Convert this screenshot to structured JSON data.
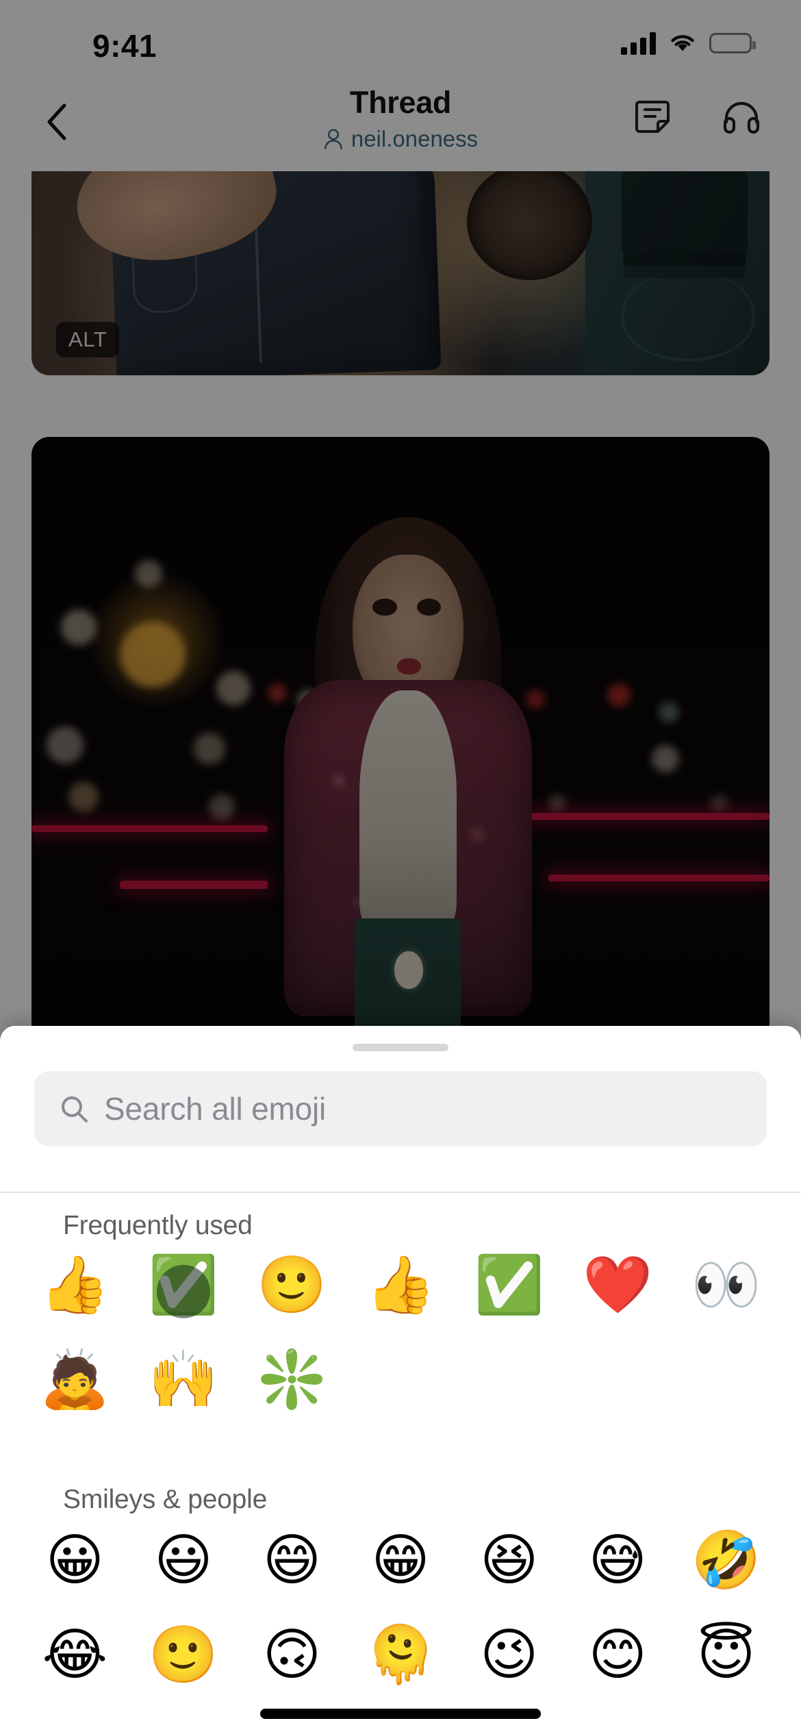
{
  "status_bar": {
    "time": "9:41",
    "cellular_icon": "cellular-bars-icon",
    "wifi_icon": "wifi-icon",
    "battery_icon": "battery-full-icon"
  },
  "header": {
    "back_icon": "chevron-left-icon",
    "title": "Thread",
    "subtitle": "neil.oneness",
    "subtitle_icon": "person-icon",
    "subtitle_color": "#3f6880",
    "actions": [
      {
        "name": "note-icon",
        "label": "Note"
      },
      {
        "name": "headphones-icon",
        "label": "Audio"
      }
    ]
  },
  "conversation": {
    "attachments": [
      {
        "name": "photo-jeans-laundry",
        "alt_badge": "ALT",
        "description": "Hand holding dark denim jeans in front of a washing machine"
      },
      {
        "name": "photo-night-portrait",
        "alt_badge": "",
        "description": "Woman in floral jacket standing on a street at night with bokeh lights"
      }
    ]
  },
  "emoji_sheet": {
    "grabber": "drag-handle",
    "search": {
      "placeholder": "Search all emoji",
      "value": "",
      "icon": "search-icon"
    },
    "sections": [
      {
        "id": "frequently-used",
        "title": "Frequently used",
        "emojis": [
          {
            "glyph": "👍",
            "name": "thumbs-up",
            "pressed": false
          },
          {
            "glyph": "✅",
            "name": "check-mark-button",
            "pressed": true
          },
          {
            "glyph": "🙂",
            "name": "slightly-smiling-face",
            "pressed": false
          },
          {
            "glyph": "👍",
            "name": "thumbs-up",
            "pressed": false
          },
          {
            "glyph": "✅",
            "name": "check-mark-button",
            "pressed": false
          },
          {
            "glyph": "❤️",
            "name": "red-heart",
            "pressed": false
          },
          {
            "glyph": "👀",
            "name": "eyes",
            "pressed": false
          },
          {
            "glyph": "🙇",
            "name": "person-bowing",
            "pressed": false
          },
          {
            "glyph": "🙌",
            "name": "raising-hands",
            "pressed": false
          },
          {
            "glyph": "❇️",
            "name": "sparkle",
            "pressed": false
          }
        ]
      },
      {
        "id": "smileys-and-people",
        "title": "Smileys & people",
        "emojis": [
          {
            "glyph": "😀",
            "name": "grinning-face",
            "pressed": false
          },
          {
            "glyph": "😃",
            "name": "grinning-face-with-big-eyes",
            "pressed": false
          },
          {
            "glyph": "😄",
            "name": "grinning-face-with-smiling-eyes",
            "pressed": false
          },
          {
            "glyph": "😁",
            "name": "beaming-face-with-smiling-eyes",
            "pressed": false
          },
          {
            "glyph": "😆",
            "name": "grinning-squinting-face",
            "pressed": false
          },
          {
            "glyph": "😅",
            "name": "grinning-face-with-sweat",
            "pressed": false
          },
          {
            "glyph": "🤣",
            "name": "rolling-on-the-floor-laughing",
            "pressed": false
          },
          {
            "glyph": "😂",
            "name": "face-with-tears-of-joy",
            "pressed": false
          },
          {
            "glyph": "🙂",
            "name": "slightly-smiling-face",
            "pressed": false
          },
          {
            "glyph": "🙃",
            "name": "upside-down-face",
            "pressed": false
          },
          {
            "glyph": "🫠",
            "name": "melting-face",
            "pressed": false
          },
          {
            "glyph": "😉",
            "name": "winking-face",
            "pressed": false
          },
          {
            "glyph": "😊",
            "name": "smiling-face-with-smiling-eyes",
            "pressed": false
          },
          {
            "glyph": "😇",
            "name": "smiling-face-with-halo",
            "pressed": false
          }
        ]
      }
    ]
  },
  "home_indicator": "home-indicator"
}
